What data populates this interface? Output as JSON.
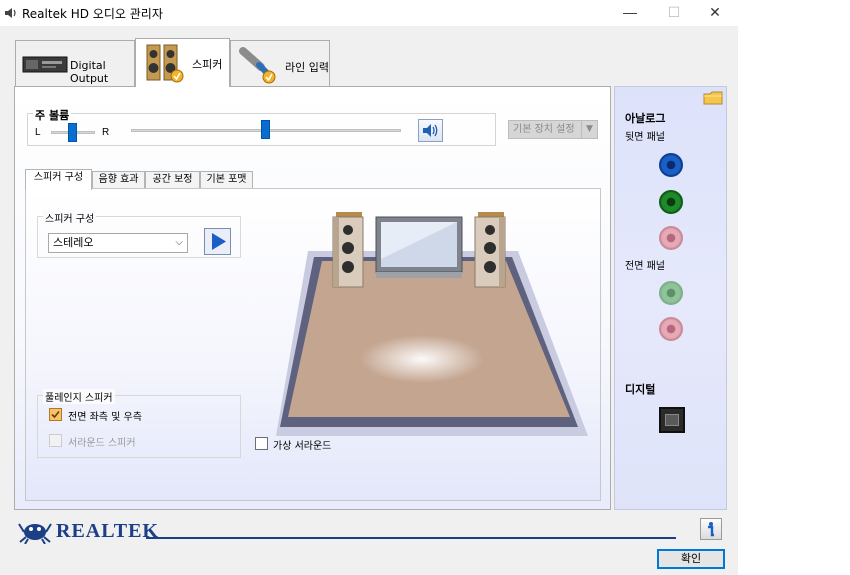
{
  "window": {
    "title": "Realtek HD 오디오 관리자",
    "controls": {
      "minimize": "—",
      "maximize": "☐",
      "close": "✕"
    }
  },
  "main_tabs": [
    {
      "label": "Digital Output",
      "icon": "digital-output-device-icon",
      "active": false
    },
    {
      "label": "스피커",
      "icon": "speaker-icon",
      "active": true
    },
    {
      "label": "라인 입력",
      "icon": "line-in-icon",
      "active": false
    }
  ],
  "volume": {
    "title": "주 볼륨",
    "left_label": "L",
    "right_label": "R",
    "balance": 0.5,
    "level": 0.5
  },
  "default_device": {
    "label": "기본 장치 설정"
  },
  "sub_tabs": [
    {
      "label": "스피커 구성",
      "active": true
    },
    {
      "label": "음향 효과",
      "active": false
    },
    {
      "label": "공간 보정",
      "active": false
    },
    {
      "label": "기본 포맷",
      "active": false
    }
  ],
  "speaker_config": {
    "group_title": "스피커 구성",
    "selected": "스테레오"
  },
  "fullrange": {
    "title": "풀레인지 스피커",
    "front": {
      "label": "전면 좌측 및 우측",
      "checked": true
    },
    "surround": {
      "label": "서라운드 스피커",
      "checked": false,
      "enabled": false
    }
  },
  "virtual_surround": {
    "label": "가상 서라운드",
    "checked": false
  },
  "connectors": {
    "analog_title": "아날로그",
    "back_panel": "뒷면 패널",
    "front_panel": "전면 패널",
    "digital_title": "디지털",
    "colors": {
      "blue": "#1a5fc8",
      "green": "#1f8a2a",
      "pink": "#e08aa0",
      "dim_green": "#8fc49a",
      "dim_pink": "#e6a9b5"
    }
  },
  "footer": {
    "brand": "REALTEK",
    "ok_label": "확인",
    "info_icon": "info-icon"
  }
}
